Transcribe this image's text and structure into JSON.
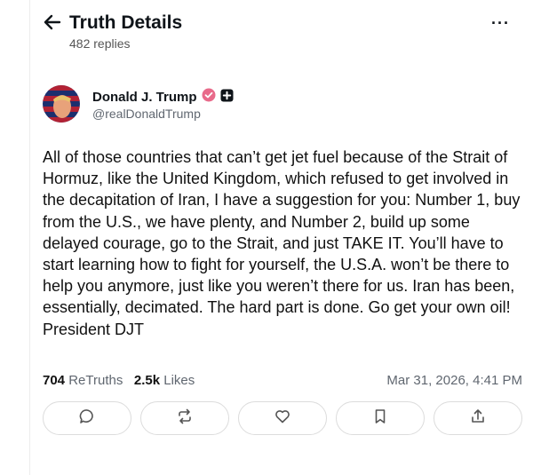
{
  "header": {
    "title": "Truth Details",
    "replies": "482 replies",
    "more": "···"
  },
  "author": {
    "name": "Donald J. Trump",
    "handle": "@realDonaldTrump"
  },
  "post": {
    "text": "All of those countries that can’t get jet fuel because of the Strait of Hormuz, like the United Kingdom, which refused to get involved in the decapitation of Iran, I have a suggestion for you: Number 1, buy from the U.S., we have plenty, and Number 2, build up some delayed courage, go to the Strait, and just TAKE IT. You’ll have to start learning how to fight for yourself, the U.S.A. won’t be there to help you anymore, just like you weren’t there for us. Iran has been, essentially, decimated. The hard part is done. Go get your own oil! President DJT"
  },
  "stats": {
    "retruths_count": "704",
    "retruths_label": "ReTruths",
    "likes_count": "2.5k",
    "likes_label": "Likes",
    "timestamp": "Mar 31, 2026, 4:41 PM"
  },
  "colors": {
    "verified_badge": "#e86a8a",
    "text": "#0f1419",
    "muted": "#606770"
  },
  "icons": [
    "back-arrow-icon",
    "more-icon",
    "verified-badge-icon",
    "plus-badge-icon",
    "reply-icon",
    "retruth-icon",
    "like-icon",
    "bookmark-icon",
    "share-icon"
  ]
}
